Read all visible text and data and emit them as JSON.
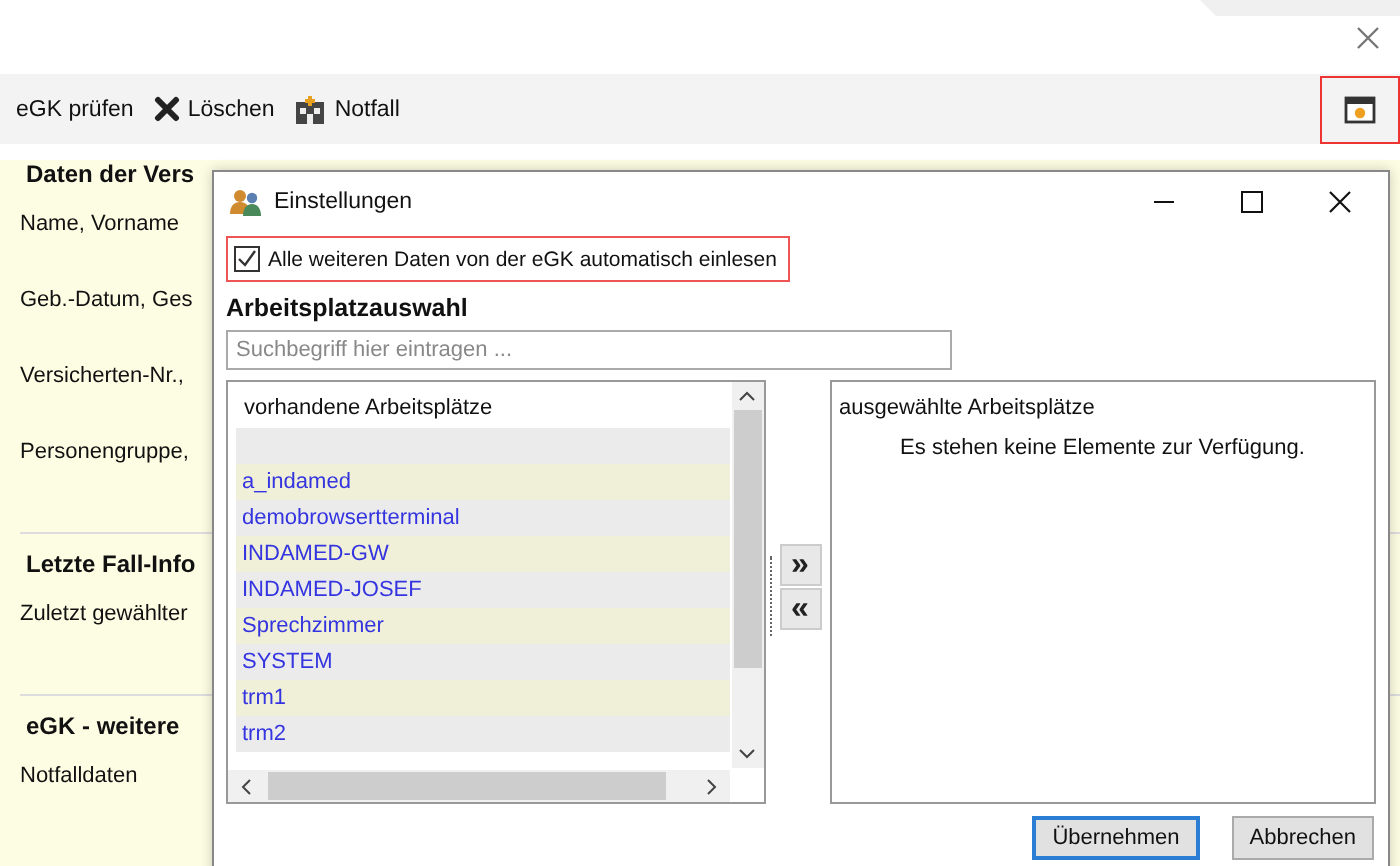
{
  "toolbar": {
    "items": [
      {
        "label": "eGK prüfen",
        "kind": "text"
      },
      {
        "label": "Löschen",
        "kind": "delete"
      },
      {
        "label": "Notfall",
        "kind": "emergency"
      }
    ]
  },
  "sections": [
    {
      "title": "Daten der Vers",
      "fields": [
        "Name, Vorname",
        "Geb.-Datum, Ges",
        "Versicherten-Nr.,",
        "Personengruppe,"
      ]
    },
    {
      "title": "Letzte Fall-Info",
      "fields": [
        "Zuletzt gewählter"
      ]
    },
    {
      "title": "eGK - weitere",
      "fields": [
        "Notfalldaten"
      ]
    }
  ],
  "dialog": {
    "title": "Einstellungen",
    "auto_read": {
      "label": "Alle weiteren Daten von der eGK automatisch einlesen",
      "checked": true
    },
    "heading": "Arbeitsplatzauswahl",
    "search": {
      "placeholder": "Suchbegriff hier eintragen ..."
    },
    "available": {
      "header": "vorhandene Arbeitsplätze",
      "items": [
        "a_indamed",
        "demobrowsertterminal",
        "INDAMED-GW",
        "INDAMED-JOSEF",
        "Sprechzimmer",
        "SYSTEM",
        "trm1",
        "trm2"
      ]
    },
    "move_buttons": [
      "»",
      "«"
    ],
    "selected": {
      "header": "ausgewählte Arbeitsplätze",
      "empty_text": "Es stehen keine Elemente zur Verfügung."
    },
    "buttons": [
      {
        "label": "Übernehmen",
        "selected": true
      },
      {
        "label": "Abbrechen",
        "selected": false
      }
    ]
  }
}
